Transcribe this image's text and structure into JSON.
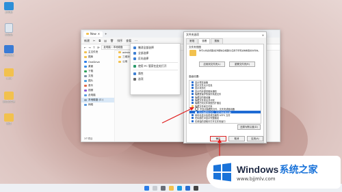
{
  "desktop": {
    "icons": [
      {
        "label": "此电脑"
      },
      {
        "label": "回收站"
      },
      {
        "label": "控制面板"
      },
      {
        "label": "1.txt"
      },
      {
        "label": "测试文件夹"
      },
      {
        "label": "新建"
      }
    ]
  },
  "explorer": {
    "tab_title": "New",
    "toolbar": {
      "new_label": "新建",
      "sort_label": "排序",
      "view_label": "查看"
    },
    "address": "此电脑 › 本地磁盘",
    "sidebar": [
      {
        "label": "主文件夹"
      },
      {
        "label": "图库"
      },
      {
        "label": "OneDrive"
      },
      {
        "label": "桌面"
      },
      {
        "label": "下载"
      },
      {
        "label": "文档"
      },
      {
        "label": "图片"
      },
      {
        "label": "音乐"
      },
      {
        "label": "视频"
      },
      {
        "label": "此电脑"
      },
      {
        "label": "本地磁盘 (C:)"
      },
      {
        "label": "网络"
      }
    ],
    "files": [
      {
        "label": "administrator"
      },
      {
        "label": "三维对象"
      },
      {
        "label": "公用"
      }
    ],
    "status": "3个项目"
  },
  "context_menu": {
    "items": [
      {
        "label": "撤消全部选择"
      },
      {
        "label": "全部选择"
      },
      {
        "label": "反向选择"
      },
      {
        "label": "使用 PC 管家在此处打开"
      },
      {
        "label": "属性"
      },
      {
        "label": "选项"
      }
    ]
  },
  "dialog": {
    "title": "文件夹选项",
    "tabs": [
      "常规",
      "查看",
      "搜索"
    ],
    "section_folder_view": "文件夹视图",
    "desc": "你可以将此视图(如详细信息或图标)应用于所有这种类型的文件夹。",
    "apply_folders": "应用到文件夹(L)",
    "reset_folders": "重置文件夹(R)",
    "section_advanced": "高级设置:",
    "advanced": [
      "显示预览窗格",
      "显示文件大小信息",
      "显示状态栏",
      "显示同步提供程序通知",
      "隐藏受保护的操作系统文件",
      "隐藏空的驱动器",
      "隐藏文件夹合并冲突",
      "隐藏已知文件类型的扩展名",
      "隐藏文件和文件夹",
      "不显示隐藏的文件、文件夹或驱动器",
      "显示隐藏的文件、文件夹和驱动器",
      "用彩色显示加密或压缩的 NTFS 文件",
      "在标题栏中显示完整路径",
      "在单独的进程中打开文件夹窗口"
    ],
    "restore_defaults": "还原为默认值(D)",
    "ok": "确定",
    "cancel": "取消",
    "apply": "应用(A)"
  },
  "watermark": {
    "brand": "Windows",
    "cn": "系统之家",
    "url": "www.bjjmlv.com"
  },
  "colors": {
    "accent": "#1f6bd4",
    "arrow": "#e02020"
  }
}
